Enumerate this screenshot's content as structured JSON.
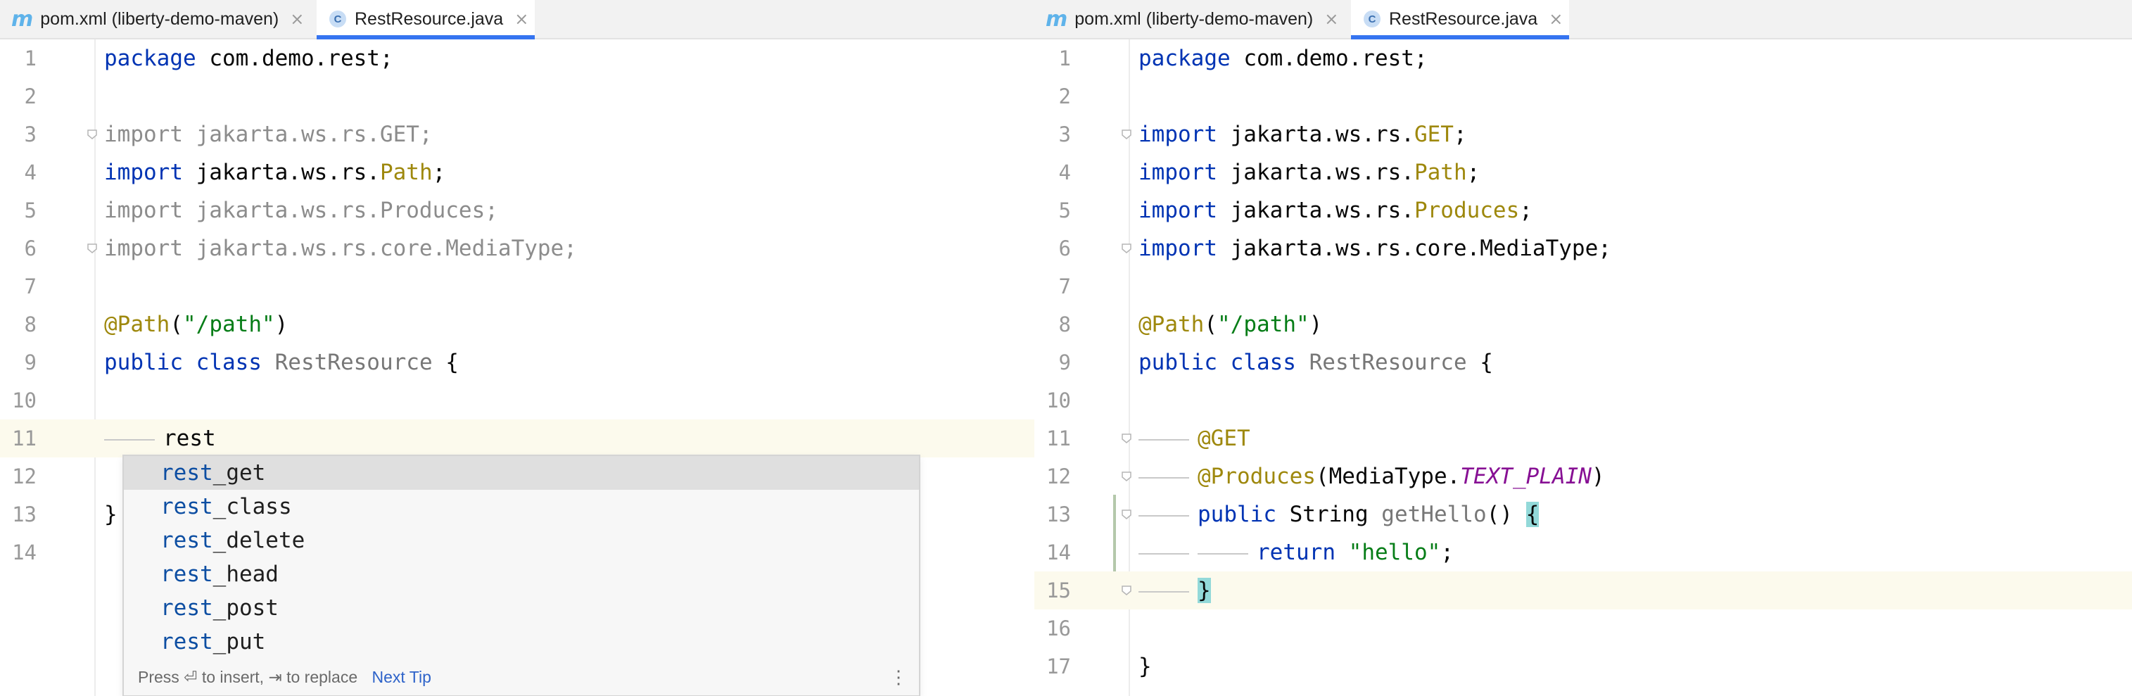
{
  "left_editor": {
    "tabs": [
      {
        "label": "pom.xml (liberty-demo-maven)",
        "icon": "maven-icon",
        "active": false
      },
      {
        "label": "RestResource.java",
        "icon": "java-class-icon",
        "active": true
      }
    ],
    "lines": [
      {
        "n": "1",
        "parts": [
          {
            "t": "package",
            "c": "kw"
          },
          {
            "t": " com.demo.rest;",
            "c": ""
          }
        ]
      },
      {
        "n": "2",
        "parts": []
      },
      {
        "n": "3",
        "parts": [
          {
            "t": "import jakarta.ws.rs.GET;",
            "c": "dim"
          }
        ]
      },
      {
        "n": "4",
        "parts": [
          {
            "t": "import",
            "c": "kw"
          },
          {
            "t": " jakarta.ws.rs.",
            "c": ""
          },
          {
            "t": "Path",
            "c": "ann"
          },
          {
            "t": ";",
            "c": ""
          }
        ]
      },
      {
        "n": "5",
        "parts": [
          {
            "t": "import jakarta.ws.rs.Produces;",
            "c": "dim"
          }
        ]
      },
      {
        "n": "6",
        "parts": [
          {
            "t": "import jakarta.ws.rs.core.MediaType;",
            "c": "dim"
          }
        ]
      },
      {
        "n": "7",
        "parts": []
      },
      {
        "n": "8",
        "parts": [
          {
            "t": "@Path",
            "c": "ann"
          },
          {
            "t": "(",
            "c": ""
          },
          {
            "t": "\"/path\"",
            "c": "str"
          },
          {
            "t": ")",
            "c": ""
          }
        ]
      },
      {
        "n": "9",
        "parts": [
          {
            "t": "public class",
            "c": "kw"
          },
          {
            "t": " ",
            "c": ""
          },
          {
            "t": "RestResource",
            "c": "cls"
          },
          {
            "t": " {",
            "c": ""
          }
        ]
      },
      {
        "n": "10",
        "parts": []
      },
      {
        "n": "11",
        "parts": [
          {
            "t": "rest",
            "c": ""
          }
        ],
        "guide": true,
        "current": true
      },
      {
        "n": "12",
        "parts": []
      },
      {
        "n": "13",
        "parts": [
          {
            "t": "}",
            "c": ""
          }
        ]
      },
      {
        "n": "14",
        "parts": []
      }
    ],
    "completion": {
      "typed": "rest",
      "items": [
        {
          "match": "rest",
          "rest": "_get"
        },
        {
          "match": "rest",
          "rest": "_class"
        },
        {
          "match": "rest",
          "rest": "_delete"
        },
        {
          "match": "rest",
          "rest": "_head"
        },
        {
          "match": "rest",
          "rest": "_post"
        },
        {
          "match": "rest",
          "rest": "_put"
        }
      ],
      "selected_index": 0,
      "footer_hint": "Press ⏎ to insert, ⇥ to replace",
      "next_tip": "Next Tip",
      "menu_glyph": "⋮"
    }
  },
  "right_editor": {
    "tabs": [
      {
        "label": "pom.xml (liberty-demo-maven)",
        "icon": "maven-icon",
        "active": false
      },
      {
        "label": "RestResource.java",
        "icon": "java-class-icon",
        "active": true
      }
    ],
    "lines": [
      {
        "n": "1",
        "parts": [
          {
            "t": "package",
            "c": "kw"
          },
          {
            "t": " com.demo.rest;",
            "c": ""
          }
        ]
      },
      {
        "n": "2",
        "parts": []
      },
      {
        "n": "3",
        "parts": [
          {
            "t": "import",
            "c": "kw"
          },
          {
            "t": " jakarta.ws.rs.",
            "c": ""
          },
          {
            "t": "GET",
            "c": "ann"
          },
          {
            "t": ";",
            "c": ""
          }
        ]
      },
      {
        "n": "4",
        "parts": [
          {
            "t": "import",
            "c": "kw"
          },
          {
            "t": " jakarta.ws.rs.",
            "c": ""
          },
          {
            "t": "Path",
            "c": "ann"
          },
          {
            "t": ";",
            "c": ""
          }
        ]
      },
      {
        "n": "5",
        "parts": [
          {
            "t": "import",
            "c": "kw"
          },
          {
            "t": " jakarta.ws.rs.",
            "c": ""
          },
          {
            "t": "Produces",
            "c": "ann"
          },
          {
            "t": ";",
            "c": ""
          }
        ]
      },
      {
        "n": "6",
        "parts": [
          {
            "t": "import",
            "c": "kw"
          },
          {
            "t": " jakarta.ws.rs.core.MediaType;",
            "c": ""
          }
        ]
      },
      {
        "n": "7",
        "parts": []
      },
      {
        "n": "8",
        "parts": [
          {
            "t": "@Path",
            "c": "ann"
          },
          {
            "t": "(",
            "c": ""
          },
          {
            "t": "\"/path\"",
            "c": "str"
          },
          {
            "t": ")",
            "c": ""
          }
        ]
      },
      {
        "n": "9",
        "parts": [
          {
            "t": "public class",
            "c": "kw"
          },
          {
            "t": " ",
            "c": ""
          },
          {
            "t": "RestResource",
            "c": "cls"
          },
          {
            "t": " {",
            "c": ""
          }
        ]
      },
      {
        "n": "10",
        "parts": []
      },
      {
        "n": "11",
        "parts": [
          {
            "t": "@GET",
            "c": "ann"
          }
        ],
        "guide": true
      },
      {
        "n": "12",
        "parts": [
          {
            "t": "@Produces",
            "c": "ann"
          },
          {
            "t": "(MediaType.",
            "c": ""
          },
          {
            "t": "TEXT_PLAIN",
            "c": "field"
          },
          {
            "t": ")",
            "c": ""
          }
        ],
        "guide": true
      },
      {
        "n": "13",
        "parts": [
          {
            "t": "public",
            "c": "kw"
          },
          {
            "t": " String ",
            "c": ""
          },
          {
            "t": "getHello",
            "c": "cls"
          },
          {
            "t": "() ",
            "c": ""
          },
          {
            "t": "{",
            "c": "bracehl"
          }
        ],
        "guide": true
      },
      {
        "n": "14",
        "parts": [
          {
            "t": "return",
            "c": "kw"
          },
          {
            "t": " ",
            "c": ""
          },
          {
            "t": "\"hello\"",
            "c": "str"
          },
          {
            "t": ";",
            "c": ""
          }
        ],
        "guide": 2
      },
      {
        "n": "15",
        "parts": [
          {
            "t": "}",
            "c": "bracehl"
          }
        ],
        "guide": true,
        "current": true
      },
      {
        "n": "16",
        "parts": []
      },
      {
        "n": "17",
        "parts": [
          {
            "t": "}",
            "c": ""
          }
        ]
      }
    ]
  },
  "colors": {
    "keyword": "#0033b3",
    "annotation": "#9e880d",
    "string": "#067d17",
    "unused_import": "#8c8c8c",
    "static_field": "#871094",
    "current_line": "#fcfaed",
    "brace_match": "#93d9d9",
    "completion_match": "#0d4ea2",
    "active_tab_underline": "#3574f0"
  }
}
